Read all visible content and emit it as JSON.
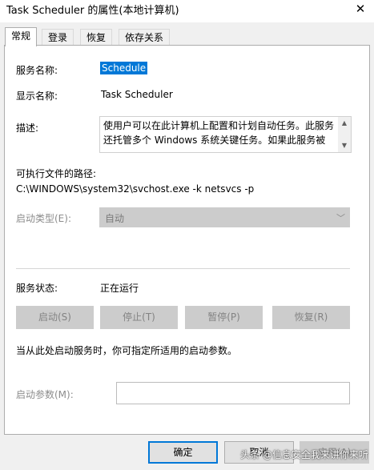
{
  "window": {
    "title": "Task Scheduler 的属性(本地计算机)",
    "close_glyph": "✕"
  },
  "tabs": [
    {
      "label": "常规",
      "active": true
    },
    {
      "label": "登录",
      "active": false
    },
    {
      "label": "恢复",
      "active": false
    },
    {
      "label": "依存关系",
      "active": false
    }
  ],
  "general": {
    "service_name_label": "服务名称:",
    "service_name_value": "Schedule",
    "display_name_label": "显示名称:",
    "display_name_value": "Task Scheduler",
    "description_label": "描述:",
    "description_lines": [
      "使用户可以在此计算机上配置和计划自动任务。此服务",
      "还托管多个 Windows 系统关键任务。如果此服务被"
    ],
    "exe_path_label": "可执行文件的路径:",
    "exe_path_value": "C:\\WINDOWS\\system32\\svchost.exe -k netsvcs -p",
    "startup_type_label": "启动类型(E):",
    "startup_type_value": "自动",
    "status_label": "服务状态:",
    "status_value": "正在运行",
    "buttons": {
      "start": "启动(S)",
      "stop": "停止(T)",
      "pause": "暂停(P)",
      "resume": "恢复(R)"
    },
    "hint_text": "当从此处启动服务时，你可指定所适用的启动参数。",
    "start_params_label": "启动参数(M):",
    "start_params_value": ""
  },
  "dialog_buttons": {
    "ok": "确定",
    "cancel": "取消",
    "apply": "应用(A)"
  },
  "watermark": "头条 @信息安全我来讲你来听",
  "colors": {
    "accent": "#0078d7",
    "disabled_bg": "#cccccc",
    "disabled_text": "#838383"
  }
}
